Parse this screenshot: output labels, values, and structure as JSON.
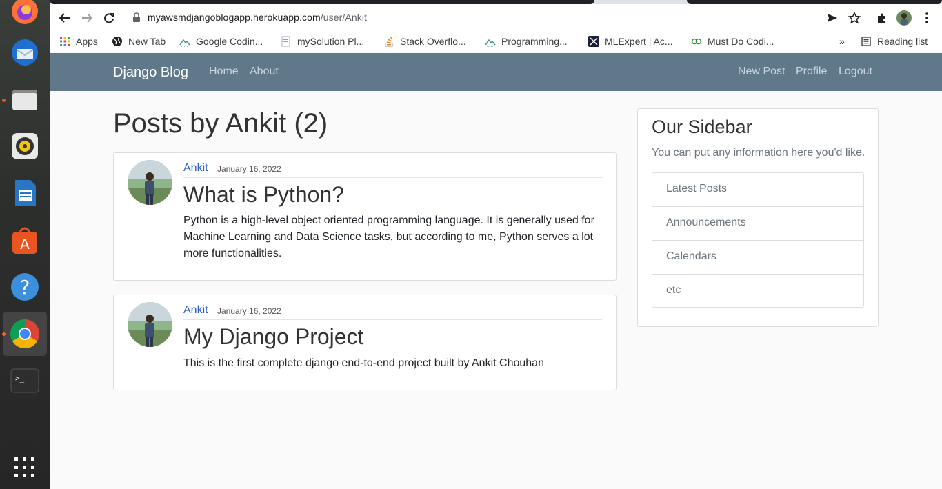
{
  "browser": {
    "url_host": "myawsmdjangoblogapp.herokuapp.com",
    "url_path": "/user/Ankit",
    "bookmarks": [
      "Apps",
      "New Tab",
      "Google Codin...",
      "mySolution Pl...",
      "Stack Overflo...",
      "Programming...",
      "MLExpert | Ac...",
      "Must Do Codi..."
    ],
    "more_label": "»",
    "reading_list": "Reading list"
  },
  "dock": {
    "apps": [
      "firefox-icon",
      "thunderbird-icon",
      "files-icon",
      "rhythmbox-icon",
      "writer-icon",
      "software-icon",
      "help-icon",
      "chrome-icon",
      "terminal-icon",
      "show-apps-icon"
    ]
  },
  "navbar": {
    "brand": "Django Blog",
    "left_links": [
      "Home",
      "About"
    ],
    "right_links": [
      "New Post",
      "Profile",
      "Logout"
    ]
  },
  "main": {
    "heading": "Posts by Ankit (2)",
    "posts": [
      {
        "author": "Ankit",
        "date": "January 16, 2022",
        "title": "What is Python?",
        "body": "Python is a high-level object oriented programming language. It is generally used for Machine Learning and Data Science tasks, but according to me, Python serves a lot more functionalities."
      },
      {
        "author": "Ankit",
        "date": "January 16, 2022",
        "title": "My Django Project",
        "body": "This is the first complete django end-to-end project built by Ankit Chouhan"
      }
    ]
  },
  "sidebar": {
    "title": "Our Sidebar",
    "text": "You can put any information here you'd like.",
    "items": [
      "Latest Posts",
      "Announcements",
      "Calendars",
      "etc"
    ]
  },
  "colors": {
    "navbar": "#5f788a",
    "link": "#2b5dcd"
  }
}
